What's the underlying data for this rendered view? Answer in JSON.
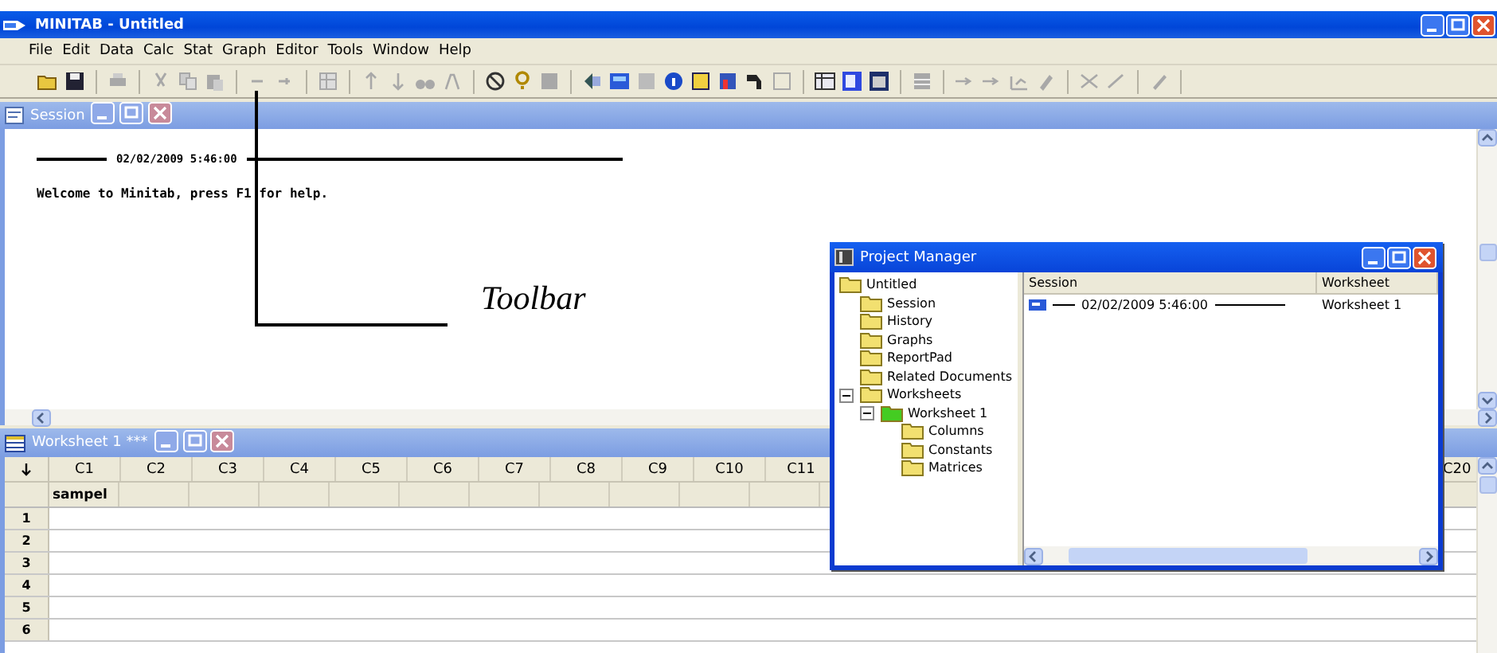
{
  "window": {
    "title": "MINITAB - Untitled"
  },
  "menu": [
    "File",
    "Edit",
    "Data",
    "Calc",
    "Stat",
    "Graph",
    "Editor",
    "Tools",
    "Window",
    "Help"
  ],
  "session": {
    "title": "Session",
    "timestamp": "02/02/2009 5:46:00",
    "welcome": "Welcome to Minitab, press F1 for help."
  },
  "annotation": {
    "label": "Toolbar"
  },
  "worksheet": {
    "title": "Worksheet 1 ***",
    "columns": [
      {
        "id": "C1",
        "name": "sampel"
      },
      {
        "id": "C2"
      },
      {
        "id": "C3"
      },
      {
        "id": "C4"
      },
      {
        "id": "C5"
      },
      {
        "id": "C6"
      },
      {
        "id": "C7"
      },
      {
        "id": "C8"
      },
      {
        "id": "C9"
      },
      {
        "id": "C10"
      },
      {
        "id": "C11"
      },
      {
        "id": "C20"
      }
    ],
    "rows": [
      "1",
      "2",
      "3",
      "4",
      "5",
      "6"
    ]
  },
  "project_manager": {
    "title": "Project Manager",
    "tree": [
      {
        "label": "Untitled",
        "kind": "folder",
        "children": [
          {
            "label": "Session",
            "kind": "folder"
          },
          {
            "label": "History",
            "kind": "folder"
          },
          {
            "label": "Graphs",
            "kind": "folder"
          },
          {
            "label": "ReportPad",
            "kind": "folder"
          },
          {
            "label": "Related Documents",
            "kind": "folder"
          },
          {
            "label": "Worksheets",
            "kind": "folder",
            "expanded": true,
            "children": [
              {
                "label": "Worksheet 1",
                "kind": "worksheet",
                "expanded": true,
                "children": [
                  {
                    "label": "Columns",
                    "kind": "folder"
                  },
                  {
                    "label": "Constants",
                    "kind": "folder"
                  },
                  {
                    "label": "Matrices",
                    "kind": "folder"
                  }
                ]
              }
            ]
          }
        ]
      }
    ],
    "list": {
      "columns": [
        "Session",
        "Worksheet"
      ],
      "rows": [
        [
          "02/02/2009 5:46:00",
          "Worksheet 1"
        ]
      ]
    }
  }
}
